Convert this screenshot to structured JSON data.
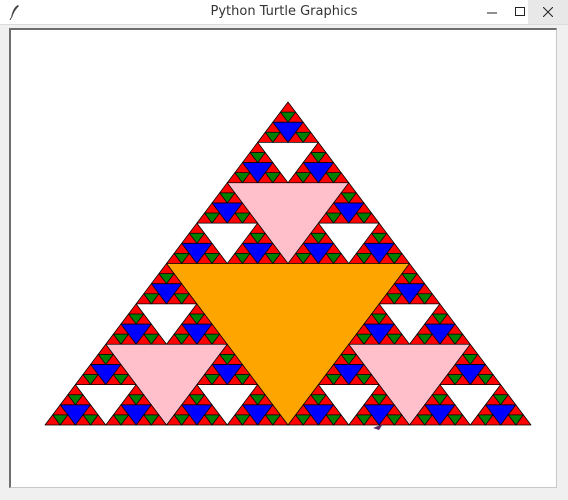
{
  "window": {
    "title": "Python Turtle Graphics",
    "icon": "feather-icon",
    "controls": [
      "minimize-icon",
      "maximize-icon",
      "close-icon"
    ]
  },
  "fractal": {
    "name": "sierpinski-triangle",
    "depth": 5,
    "level_colors": [
      "#ffa500",
      "#ffc0cb",
      "#ffffff",
      "#0000ff",
      "#008000"
    ],
    "base_color": "#ff0000",
    "outline_color": "#000000"
  }
}
